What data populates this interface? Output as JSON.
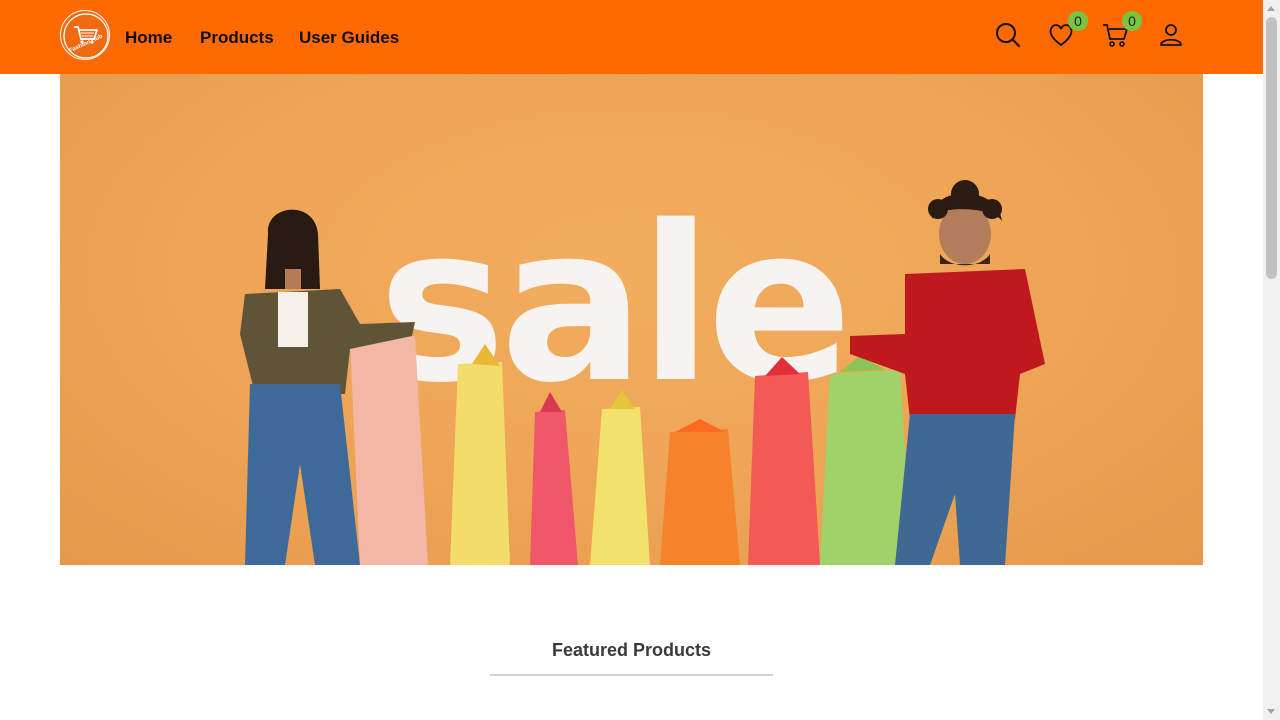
{
  "nav": {
    "logo_text": "Fashion Hub",
    "links": [
      "Home",
      "Products",
      "User Guides"
    ],
    "wishlist_count": "0",
    "cart_count": "0"
  },
  "hero": {
    "banner_text": "sale"
  },
  "featured": {
    "title": "Featured Products"
  },
  "colors": {
    "nav_bg": "#ff6a00",
    "badge": "#7cc243",
    "hero_bg": "#eea456"
  }
}
